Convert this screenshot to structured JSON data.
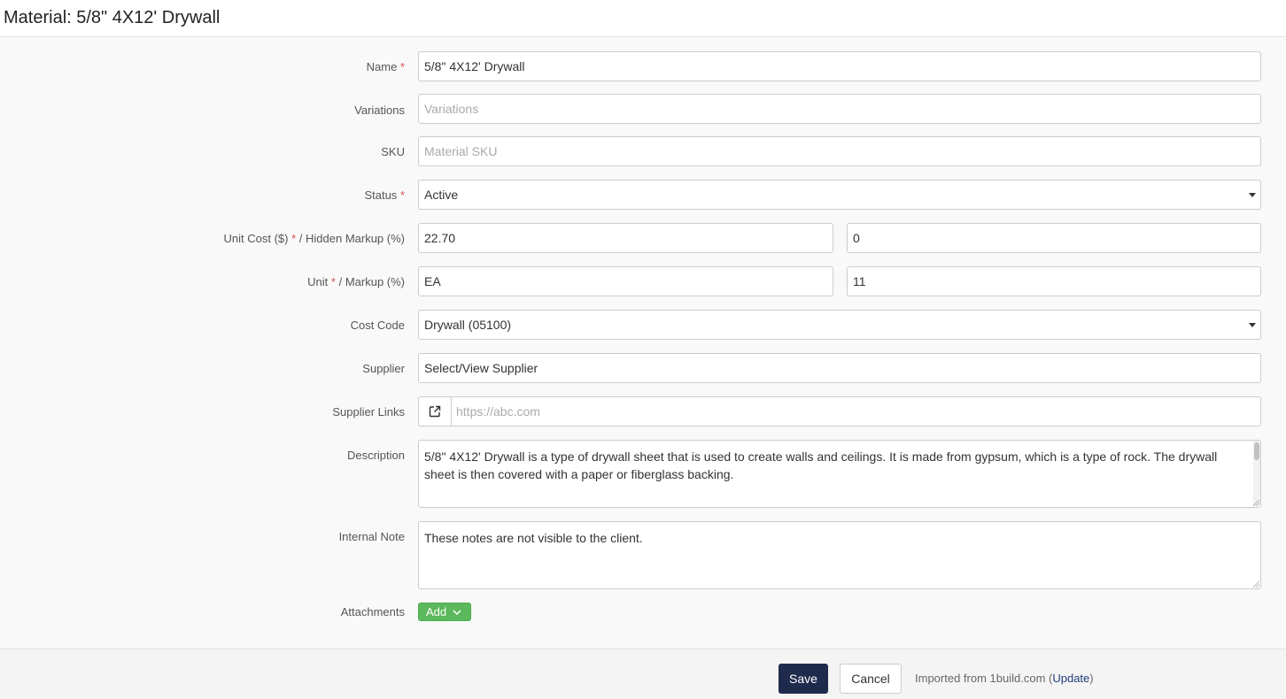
{
  "page": {
    "title": "Material: 5/8\" 4X12' Drywall"
  },
  "fields": {
    "name": {
      "label": "Name",
      "value": "5/8\" 4X12' Drywall"
    },
    "variations": {
      "label": "Variations",
      "placeholder": "Variations"
    },
    "sku": {
      "label": "SKU",
      "placeholder": "Material SKU"
    },
    "status": {
      "label": "Status",
      "value": "Active"
    },
    "unit_cost": {
      "label_a": "Unit Cost ($)",
      "label_b": " / Hidden Markup (%)",
      "value": "22.70",
      "hidden_markup": "0"
    },
    "unit": {
      "label_a": "Unit",
      "label_b": " / Markup (%)",
      "value": "EA",
      "markup": "11"
    },
    "cost_code": {
      "label": "Cost Code",
      "value": "Drywall (05100)"
    },
    "supplier": {
      "label": "Supplier",
      "value": "Select/View Supplier"
    },
    "supplier_links": {
      "label": "Supplier Links",
      "placeholder": "https://abc.com"
    },
    "description": {
      "label": "Description",
      "value": "5/8\" 4X12' Drywall is a type of drywall sheet that is used to create walls and ceilings. It is made from gypsum, which is a type of rock. The drywall sheet is then covered with a paper or fiberglass backing."
    },
    "internal_note": {
      "label": "Internal Note",
      "placeholder": "These notes are not visible to the client."
    },
    "attachments": {
      "label": "Attachments",
      "add_label": "Add"
    }
  },
  "required_marker": "*",
  "footer": {
    "save_label": "Save",
    "cancel_label": "Cancel",
    "imported_text": "Imported from 1build.com (",
    "update_label": "Update",
    "imported_close": ")"
  },
  "colors": {
    "primary": "#1f2b4d",
    "success": "#5cb85c",
    "required": "#d9534f"
  },
  "icons": {
    "external_link": "external-link-icon",
    "dropdown": "caret-down-icon",
    "add_menu": "chevron-down-icon"
  }
}
